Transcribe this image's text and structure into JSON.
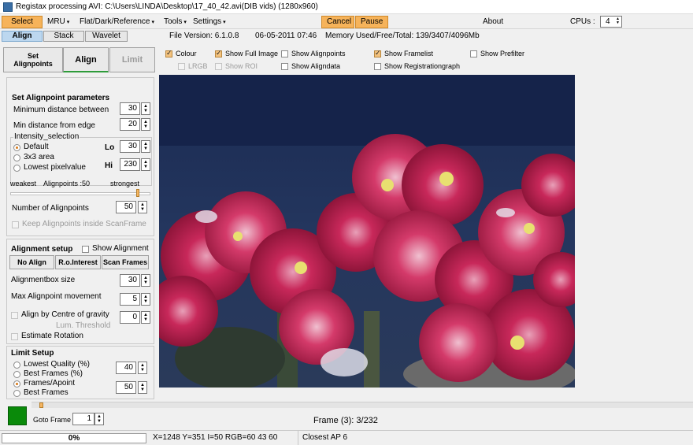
{
  "window": {
    "title": "Registax processing AVI: C:\\Users\\LINDA\\Desktop\\17_40_42.avi(DIB vids) (1280x960)"
  },
  "menu": {
    "select": "Select",
    "mru": "MRU",
    "flat": "Flat/Dark/Reference",
    "tools": "Tools",
    "settings": "Settings",
    "cancel": "Cancel",
    "pause": "Pause",
    "about": "About",
    "cpus_label": "CPUs :",
    "cpus_value": "4"
  },
  "tabs": {
    "align": "Align",
    "stack": "Stack",
    "wavelet": "Wavelet"
  },
  "info": {
    "version": "File Version: 6.1.0.8",
    "date": "06-05-2011 07:46",
    "memory": "Memory Used/Free/Total: 139/3407/4096Mb"
  },
  "mode_tabs": {
    "set_alignpoints_line1": "Set",
    "set_alignpoints_line2": "Alignpoints",
    "align": "Align",
    "limit": "Limit"
  },
  "options": {
    "colour": "Colour",
    "lrgb": "LRGB",
    "show_full_image": "Show Full Image",
    "show_roi": "Show ROI",
    "show_alignpoints": "Show Alignpoints",
    "show_aligndata": "Show Aligndata",
    "show_framelist": "Show Framelist",
    "show_registrationgraph": "Show Registrationgraph",
    "show_prefilter": "Show Prefilter"
  },
  "alignpoint_params": {
    "heading": "Set Alignpoint parameters",
    "min_distance_between": "Minimum distance between",
    "min_distance_between_value": "30",
    "min_distance_edge": "Min distance from edge",
    "min_distance_edge_value": "20",
    "intensity_selection": "Intensity_selection",
    "default": "Default",
    "area3x3": "3x3 area",
    "lowest_pixelvalue": "Lowest pixelvalue",
    "lo_label": "Lo",
    "lo_value": "30",
    "hi_label": "Hi",
    "hi_value": "230",
    "weakest": "weakest",
    "alignpoints_count": "Alignpoints :50",
    "strongest": "strongest",
    "number_of_alignpoints": "Number of Alignpoints",
    "number_of_alignpoints_value": "50",
    "keep_inside_scanframe": "Keep Alignpoints inside ScanFrame"
  },
  "alignment_setup": {
    "heading": "Alignment setup",
    "show_alignment": "Show Alignment",
    "no_align": "No Align",
    "ro_interest": "R.o.Interest",
    "scan_frames": "Scan Frames",
    "alignmentbox_size": "Alignmentbox size",
    "alignmentbox_size_value": "30",
    "max_movement": "Max Alignpoint movement",
    "max_movement_value": "5",
    "align_by_centre": "Align by Centre of gravity",
    "align_by_centre_value": "0",
    "lum_threshold": "Lum. Threshold",
    "estimate_rotation": "Estimate Rotation"
  },
  "limit_setup": {
    "heading": "Limit Setup",
    "lowest_quality": "Lowest Quality (%)",
    "lowest_quality_value": "40",
    "best_frames_pct": "Best Frames (%)",
    "frames_apoint": "Frames/Apoint",
    "best_frames": "Best Frames",
    "best_frames_value": "50"
  },
  "bottom": {
    "goto_frame": "Goto Frame",
    "goto_frame_value": "1",
    "frame_info": "Frame (3): 3/232"
  },
  "status": {
    "progress": "0%",
    "progress_value": 0,
    "coords": "X=1248 Y=351 I=50 RGB=60 43 60",
    "closest_ap": "Closest AP 6"
  },
  "colors": {
    "accent_orange": "#f6b35a",
    "tab_blue": "#bcd7ef",
    "progress_green": "#27c227",
    "indicator_green": "#0a8a0a"
  }
}
